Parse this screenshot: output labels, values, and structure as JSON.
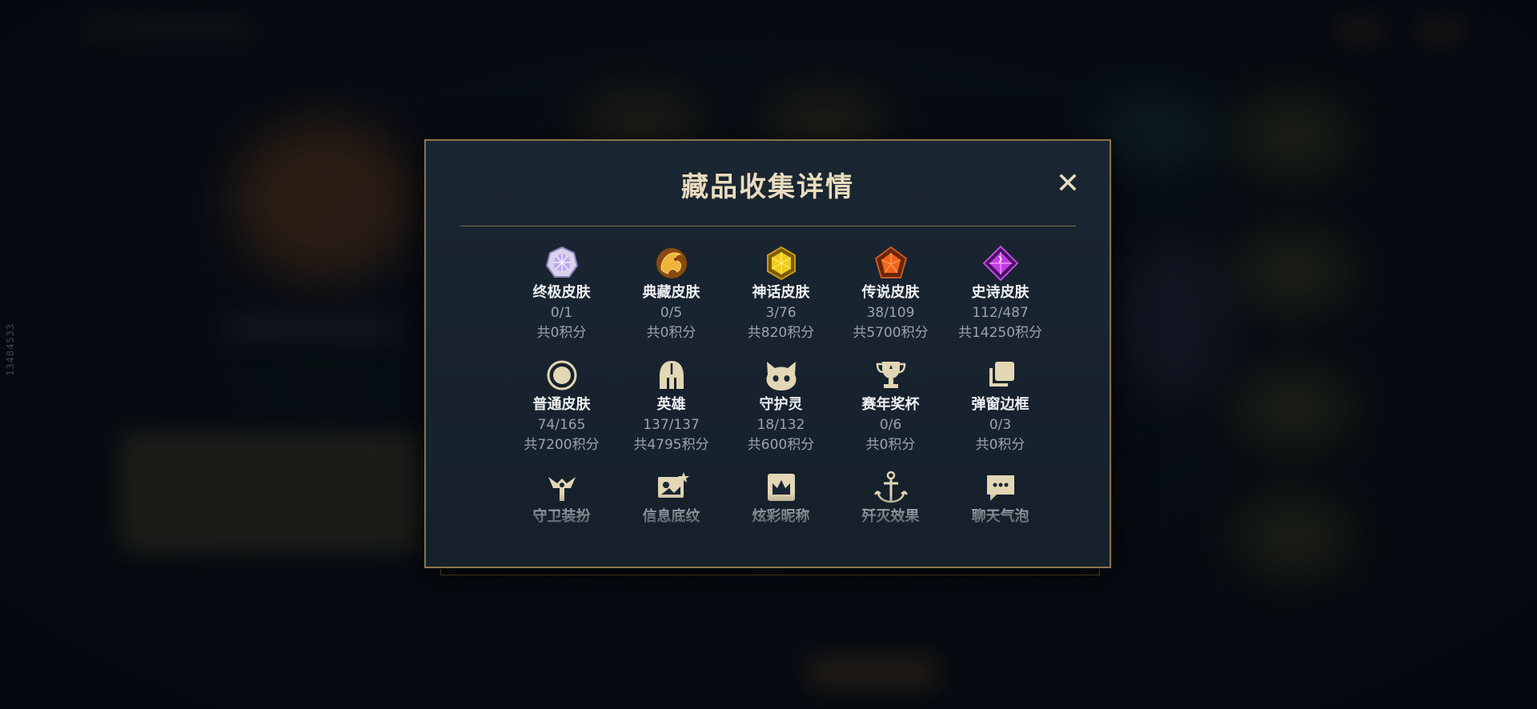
{
  "side_id": "13484533",
  "modal": {
    "title": "藏品收集详情",
    "close_label": "✕"
  },
  "collections": [
    {
      "name": "终极皮肤",
      "count": "0/1",
      "points": "共0积分",
      "icon": "ultimate-gem-icon",
      "color": "#c9b6f0"
    },
    {
      "name": "典藏皮肤",
      "count": "0/5",
      "points": "共0积分",
      "icon": "prestige-dragon-icon",
      "color": "#e8a93a"
    },
    {
      "name": "神话皮肤",
      "count": "3/76",
      "points": "共820积分",
      "icon": "mythic-gem-icon",
      "color": "#e8c21a"
    },
    {
      "name": "传说皮肤",
      "count": "38/109",
      "points": "共5700积分",
      "icon": "legendary-gem-icon",
      "color": "#e8561a"
    },
    {
      "name": "史诗皮肤",
      "count": "112/487",
      "points": "共14250积分",
      "icon": "epic-gem-icon",
      "color": "#b43ad6"
    },
    {
      "name": "普通皮肤",
      "count": "74/165",
      "points": "共7200积分",
      "icon": "normal-skin-icon",
      "color": "#d8cba8"
    },
    {
      "name": "英雄",
      "count": "137/137",
      "points": "共4795积分",
      "icon": "champion-helmet-icon",
      "color": "#d8cba8"
    },
    {
      "name": "守护灵",
      "count": "18/132",
      "points": "共600积分",
      "icon": "companion-icon",
      "color": "#d8cba8"
    },
    {
      "name": "赛年奖杯",
      "count": "0/6",
      "points": "共0积分",
      "icon": "trophy-icon",
      "color": "#d8cba8"
    },
    {
      "name": "弹窗边框",
      "count": "0/3",
      "points": "共0积分",
      "icon": "border-frames-icon",
      "color": "#d8cba8"
    },
    {
      "name": "守卫装扮",
      "icon": "ward-skin-icon",
      "color": "#d8cba8"
    },
    {
      "name": "信息底纹",
      "icon": "banner-icon",
      "color": "#d8cba8"
    },
    {
      "name": "炫彩昵称",
      "icon": "crown-nickname-icon",
      "color": "#d8cba8"
    },
    {
      "name": "歼灭效果",
      "icon": "anchor-effect-icon",
      "color": "#d8cba8"
    },
    {
      "name": "聊天气泡",
      "icon": "chat-bubble-icon",
      "color": "#d8cba8"
    }
  ]
}
